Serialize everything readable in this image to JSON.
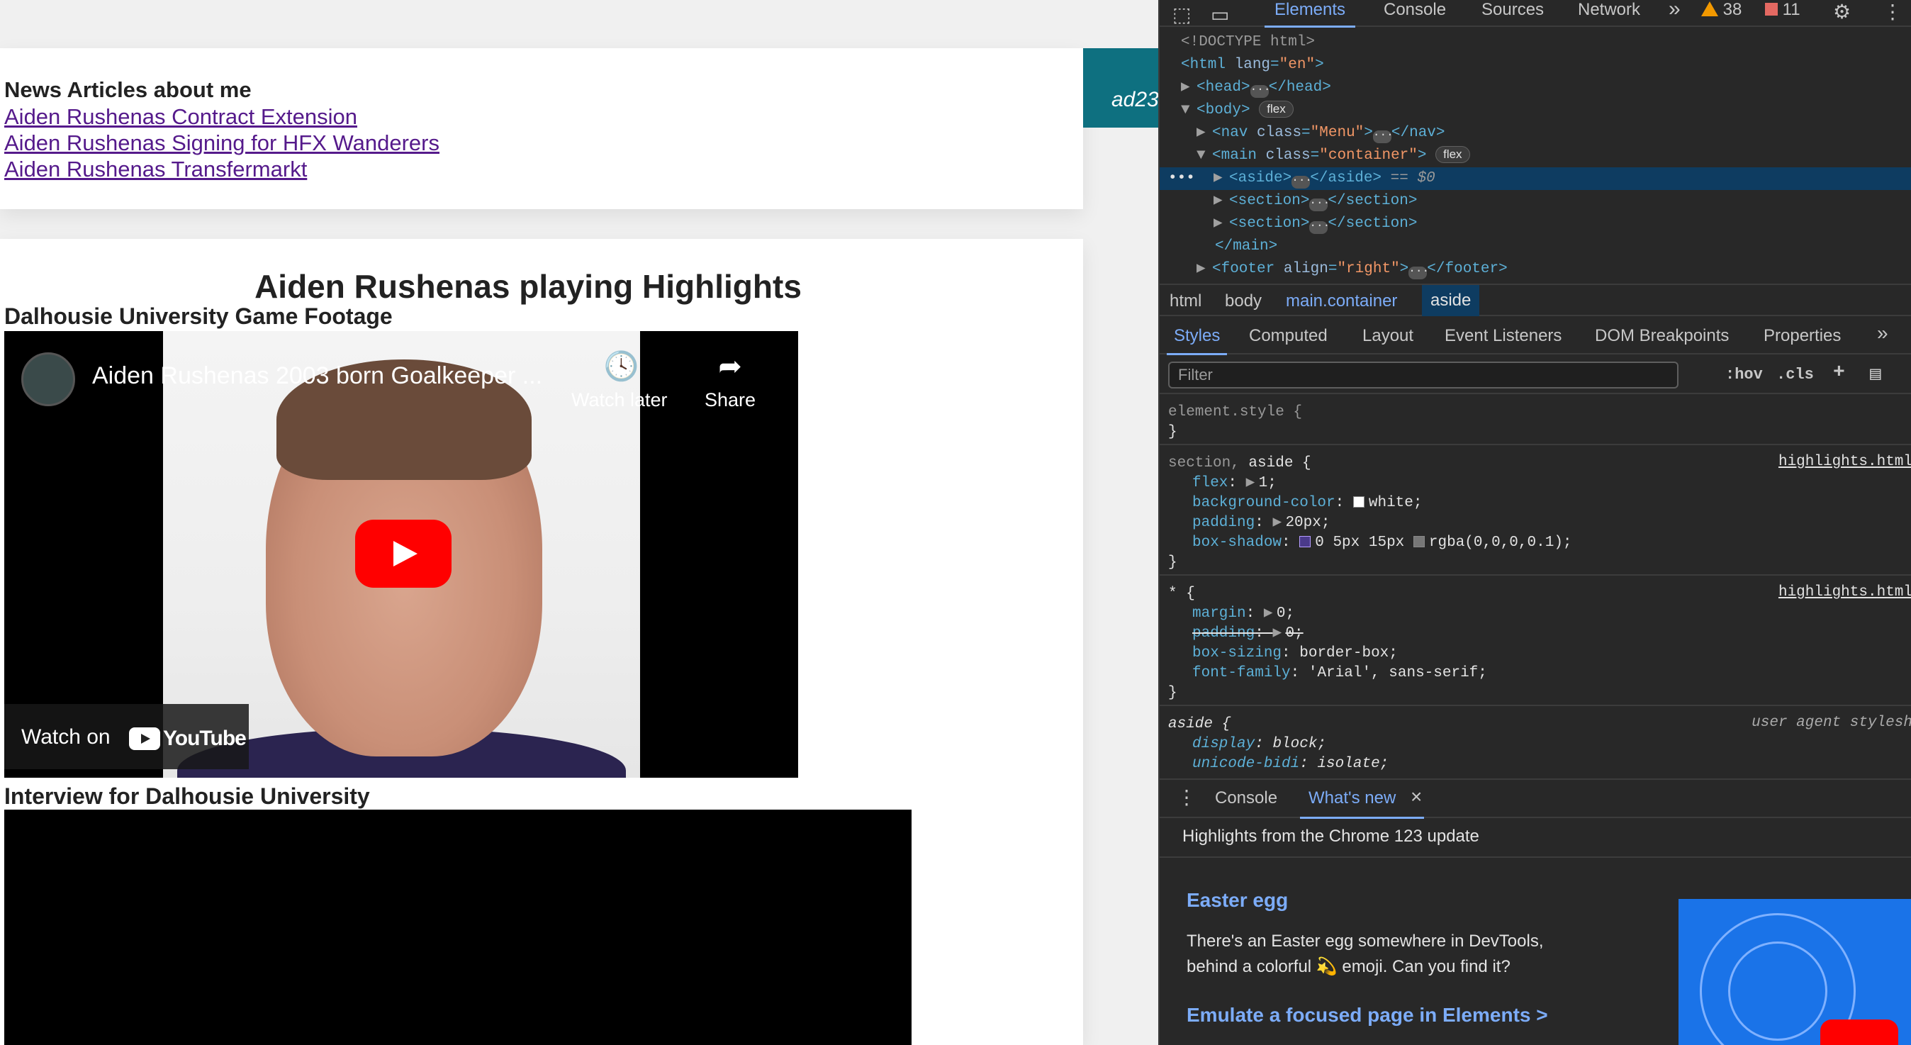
{
  "page": {
    "aside": {
      "heading": "News Articles about me",
      "links": [
        "Aiden Rushenas Contract Extension",
        "Aiden Rushenas Signing for HFX Wanderers",
        "Aiden Rushenas Transfermarkt"
      ]
    },
    "nav_fragment": "ad23",
    "section": {
      "title": "Aiden Rushenas playing Highlights",
      "video1_label": "Dalhousie University Game Footage",
      "video1_title": "Aiden Rushenas 2003 born Goalkeeper ...",
      "watch_later": "Watch later",
      "share": "Share",
      "watch_on": "Watch on",
      "youtube": "YouTube",
      "video2_label": "Interview for Dalhousie University"
    }
  },
  "devtools": {
    "tabs": [
      "Elements",
      "Console",
      "Sources",
      "Network"
    ],
    "more": "»",
    "warnings": "38",
    "errors": "11",
    "dom": {
      "l1": "<!DOCTYPE html>",
      "html_open": "<html",
      "lang_attr": "lang",
      "lang_val": "\"en\"",
      "head": "<head>",
      "head_close": "</head>",
      "body": "<body>",
      "body_pill": "flex",
      "nav_open": "<nav",
      "nav_attr": "class",
      "nav_val": "\"Menu\"",
      "nav_close": "</nav>",
      "main_open": "<main",
      "main_attr": "class",
      "main_val": "\"container\"",
      "main_pill": "flex",
      "aside_open": "<aside>",
      "aside_close": "</aside>",
      "aside_eq": "== $0",
      "section_open": "<section>",
      "section_close": "</section>",
      "main_close": "</main>",
      "footer_open": "<footer",
      "footer_attr": "align",
      "footer_val": "\"right\"",
      "footer_close": "</footer>",
      "row_marker": "•••"
    },
    "breadcrumbs": [
      "html",
      "body",
      "main.container",
      "aside"
    ],
    "subtabs": [
      "Styles",
      "Computed",
      "Layout",
      "Event Listeners",
      "DOM Breakpoints",
      "Properties"
    ],
    "filter_placeholder": "Filter",
    "hov": ":hov",
    "cls": ".cls",
    "styles": {
      "element_style": "element.style {",
      "close": "}",
      "rule1_sel_dim": "section,",
      "rule1_sel": " aside {",
      "rule1_src": "highlights.html",
      "flex_p": "flex",
      "flex_v": "1;",
      "bg_p": "background-color",
      "bg_v": "white;",
      "pad_p": "padding",
      "pad_v": "20px;",
      "shadow_p": "box-shadow",
      "shadow_v1": "0 5px 15px",
      "shadow_v2": "rgba(0,0,0,0.1);",
      "rule2_sel": "* {",
      "rule2_src": "highlights.html",
      "margin_p": "margin",
      "margin_v": "0;",
      "padding_p": "padding",
      "padding_v": "0;",
      "boxsizing_p": "box-sizing",
      "boxsizing_v": "border-box;",
      "font_p": "font-family",
      "font_v": "'Arial', sans-serif;",
      "rule3_sel": "aside {",
      "rule3_src": "user agent stylesh",
      "display_p": "display",
      "display_v": "block;",
      "bidi_p": "unicode-bidi",
      "bidi_v": "isolate;"
    },
    "drawer": {
      "tabs": [
        "Console",
        "What's new"
      ],
      "close": "×",
      "headline": "Highlights from the Chrome 123 update",
      "item1_title": "Easter egg",
      "item1_text": "There's an Easter egg somewhere in DevTools, behind a colorful 💫 emoji. Can you find it?",
      "item2_title": "Emulate a focused page in Elements >"
    },
    "colors": {
      "accent": "#7cacf8",
      "selection": "#0e3c61",
      "warning": "#f29900",
      "error": "#e46962"
    }
  }
}
